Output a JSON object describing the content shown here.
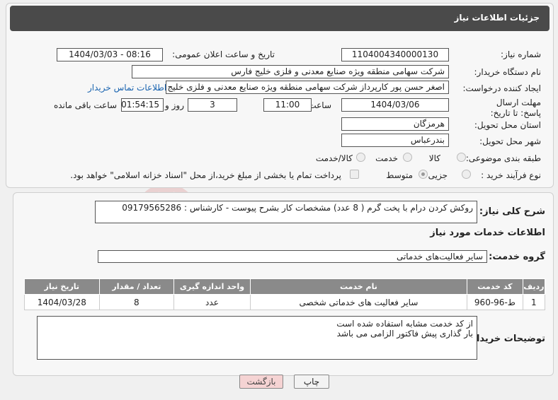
{
  "header": {
    "title": "جزئیات اطلاعات نیاز"
  },
  "form": {
    "need_number_label": "شماره نیاز:",
    "need_number": "1104004340000130",
    "announce_label": "تاریخ و ساعت اعلان عمومی:",
    "announce_value": "1404/03/03 - 08:16",
    "buyer_org_label": "نام دستگاه خریدار:",
    "buyer_org": "شرکت سهامی منطقه ویژه صنایع معدنی و فلزی خلیج فارس",
    "creator_label": "ایجاد کننده درخواست:",
    "creator": "اصغر حسن پور کارپرداز شرکت سهامی منطقه ویژه صنایع معدنی و فلزی خلیج فارس",
    "contact_link": "اطلاعات تماس خریدار",
    "deadline_label": "مهلت ارسال پاسخ: تا تاریخ:",
    "deadline_date": "1404/03/06",
    "time_label": "ساعت",
    "deadline_time": "11:00",
    "days_value": "3",
    "days_label": "روز و",
    "remaining_time": "01:54:15",
    "remaining_label": "ساعت باقی مانده",
    "province_label": "استان محل تحویل:",
    "province": "هرمزگان",
    "city_label": "شهر محل تحویل:",
    "city": "بندرعباس",
    "category_label": "طبقه بندی موضوعی:",
    "category_options": [
      "کالا",
      "خدمت",
      "کالا/خدمت"
    ],
    "process_label": "نوع فرآیند خرید :",
    "process_options": [
      "جزیی",
      "متوسط"
    ],
    "payment_note": "پرداخت تمام یا بخشی از مبلغ خرید،از محل \"اسناد خزانه اسلامی\" خواهد بود."
  },
  "need": {
    "summary_label": "شرح کلی نیاز:",
    "summary": "روکش کردن درام با پخت گرم  ( 8 عدد) مشخصات کار بشرح پیوست - کارشناس : 09179565286",
    "services_title": "اطلاعات خدمات مورد نیاز",
    "group_label": "گروه خدمت:",
    "group_value": "سایر فعالیت‌های خدماتی"
  },
  "table": {
    "headers": [
      "ردیف",
      "کد خدمت",
      "نام خدمت",
      "واحد اندازه گیری",
      "تعداد / مقدار",
      "تاریخ نیاز"
    ],
    "rows": [
      [
        "1",
        "ط-96-960",
        "سایر فعالیت های خدماتی شخصی",
        "عدد",
        "8",
        "1404/03/28"
      ]
    ]
  },
  "notes": {
    "label": "توضیحات خریدار:",
    "line1": "از کد خدمت مشابه استفاده شده است",
    "line2": "بار گذاری پیش فاکتور الزامی می باشد"
  },
  "buttons": {
    "print": "چاپ",
    "back": "بازگشت"
  },
  "watermark": {
    "text": "AriaTender.neT"
  },
  "colors": {
    "header_bg": "#4a4a4a",
    "table_header_bg": "#8a8a8a",
    "link": "#1a64b0",
    "back_button_bg": "#f5d3d3"
  }
}
